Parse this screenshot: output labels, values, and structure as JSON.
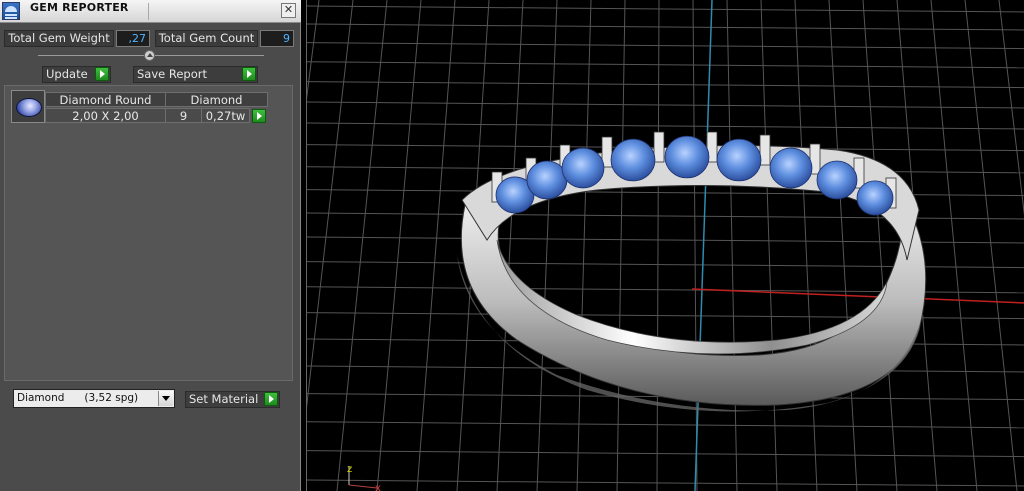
{
  "window": {
    "title": "GEM REPORTER"
  },
  "summary": {
    "weight_label": "Total Gem Weight",
    "weight_value": ",27",
    "count_label": "Total Gem Count",
    "count_value": "9"
  },
  "buttons": {
    "update": "Update",
    "save_report": "Save Report",
    "set_material": "Set Material"
  },
  "gem_table": {
    "header_shape": "Diamond Round",
    "header_material": "Diamond",
    "size": "2,00 X 2,00",
    "count": "9",
    "weight": "0,27tw"
  },
  "material": {
    "selected": "Diamond      (3,52 spg)"
  },
  "viewport": {
    "axis_labels": {
      "z": "z",
      "x": "x"
    },
    "colors": {
      "y_axis": "#2f8bb0",
      "x_axis": "#c02020",
      "grid": "#555555",
      "gem": "#5f8fe0"
    }
  }
}
